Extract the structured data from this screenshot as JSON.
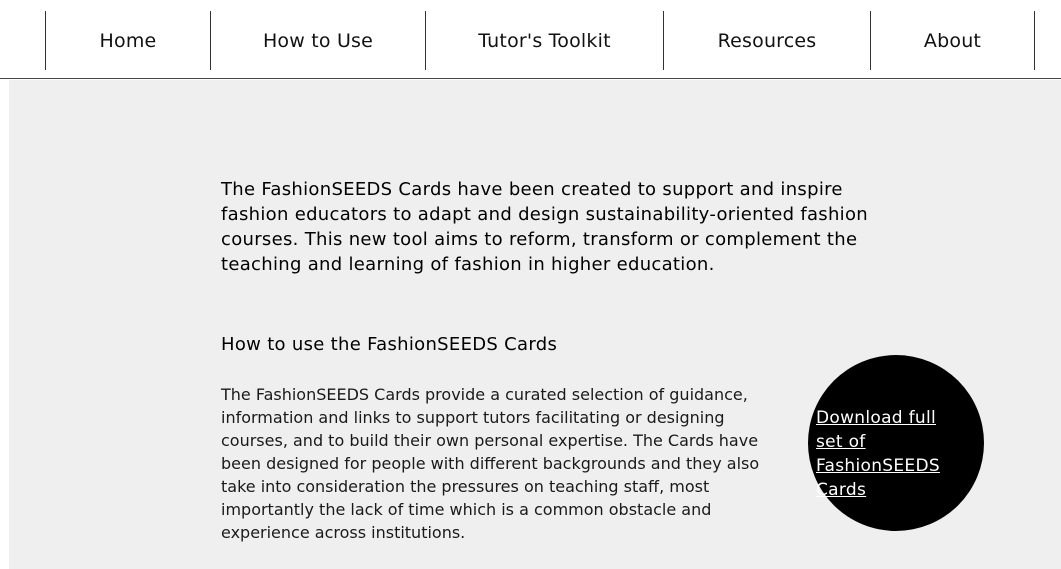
{
  "nav": {
    "items": [
      {
        "label": "Home"
      },
      {
        "label": "How to Use"
      },
      {
        "label": "Tutor's Toolkit"
      },
      {
        "label": "Resources"
      },
      {
        "label": "About"
      }
    ]
  },
  "main": {
    "intro": "The FashionSEEDS Cards have been created to support and inspire fashion educators to adapt and design sustainability-oriented fashion courses. This new tool aims to reform, transform or complement the teaching and learning of fashion in higher education.",
    "section_heading": "How to use the FashionSEEDS Cards",
    "body": "The FashionSEEDS Cards provide a curated selection of guidance, information and links to support tutors facilitating or designing courses, and to build their own personal expertise. The Cards have been designed for people with different backgrounds and they also take into consideration the pressures on teaching staff, most importantly the lack of time which is a common obstacle and experience across institutions.",
    "download_link": "Download full set of FashionSEEDS Cards "
  }
}
